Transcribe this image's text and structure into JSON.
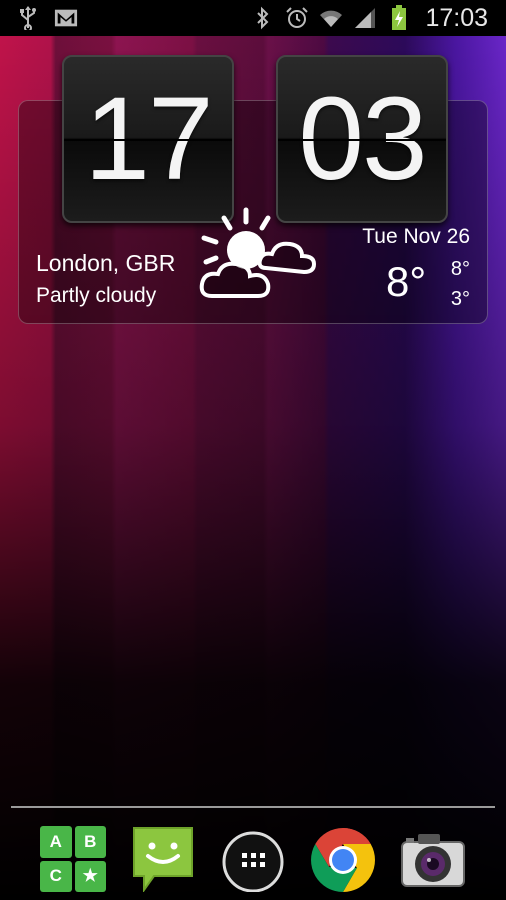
{
  "status_bar": {
    "time": "17:03",
    "left_icons": [
      "usb-icon",
      "gmail-icon"
    ],
    "right_icons": [
      "bluetooth-icon",
      "alarm-icon",
      "wifi-icon",
      "signal-icon",
      "battery-charging-icon"
    ]
  },
  "clock_widget": {
    "hours": "17",
    "minutes": "03",
    "location": "London, GBR",
    "condition": "Partly cloudy",
    "weather_icon": "partly-cloudy-icon",
    "date": "Tue Nov 26",
    "temp_now": "8°",
    "temp_high": "8°",
    "temp_low": "3°"
  },
  "dock": {
    "apps": [
      {
        "name": "abc-app",
        "letters": [
          "A",
          "B",
          "C",
          "★"
        ]
      },
      {
        "name": "messaging-app"
      },
      {
        "name": "app-drawer"
      },
      {
        "name": "chrome-app"
      },
      {
        "name": "camera-app"
      }
    ]
  },
  "colors": {
    "abc_green": "#49b648",
    "messaging_green": "#8cc63f",
    "chrome_red": "#db4437",
    "chrome_yellow": "#f4c20d",
    "chrome_green": "#0f9d58",
    "chrome_blue": "#4285f4"
  }
}
